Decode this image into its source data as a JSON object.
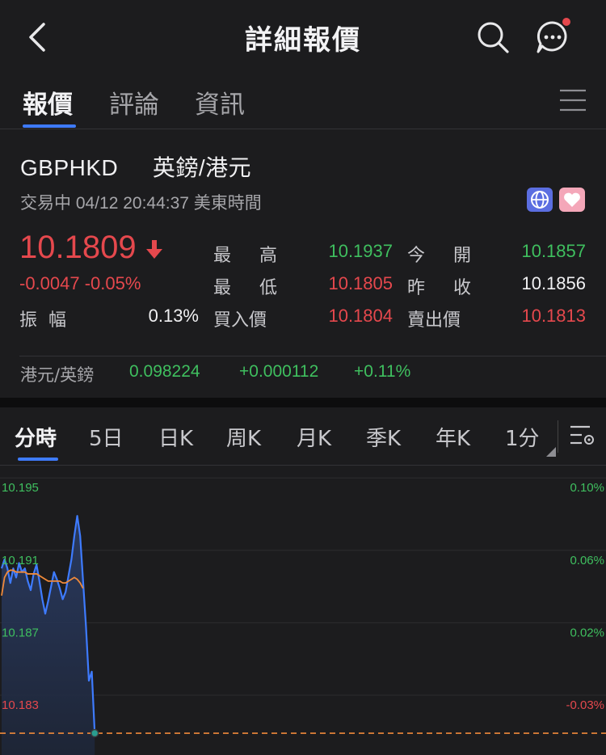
{
  "header": {
    "title": "詳細報價",
    "back_icon": "chevron-left-icon",
    "search_icon": "search-icon",
    "chat_icon": "chat-bubble-icon",
    "notification_dot_color": "#e5484d"
  },
  "tabs": [
    {
      "label": "報價",
      "active": true
    },
    {
      "label": "評論",
      "active": false
    },
    {
      "label": "資訊",
      "active": false
    }
  ],
  "quote": {
    "symbol": "GBPHKD",
    "name": "英鎊/港元",
    "status": "交易中 04/12 20:44:37 美東時間",
    "price": "10.1809",
    "direction": "down",
    "change": "-0.0047 -0.05%",
    "amplitude_label": "振幅",
    "amplitude_value": "0.13%",
    "stats": {
      "high_label": "最 高",
      "high": "10.1937",
      "open_label": "今 開",
      "open": "10.1857",
      "low_label": "最 低",
      "low": "10.1805",
      "prev_close_label": "昨 收",
      "prev_close": "10.1856",
      "bid_label": "買入價",
      "bid": "10.1804",
      "ask_label": "賣出價",
      "ask": "10.1813"
    },
    "inverse": {
      "label": "港元/英鎊",
      "value": "0.098224",
      "change": "+0.000112",
      "change_pct": "+0.11%"
    }
  },
  "chart_tabs": [
    {
      "label": "分時",
      "active": true
    },
    {
      "label": "5日",
      "active": false
    },
    {
      "label": "日K",
      "active": false
    },
    {
      "label": "周K",
      "active": false
    },
    {
      "label": "月K",
      "active": false
    },
    {
      "label": "季K",
      "active": false
    },
    {
      "label": "年K",
      "active": false
    },
    {
      "label": "1分",
      "active": false
    }
  ],
  "chart_data": {
    "type": "line",
    "y_left_labels": [
      "10.195",
      "10.191",
      "10.187",
      "10.183"
    ],
    "y_right_labels": [
      "0.10%",
      "0.06%",
      "0.02%",
      "-0.03%"
    ],
    "prev_close": 10.1856,
    "ylim": [
      10.1805,
      10.1955
    ],
    "series": [
      {
        "values": [
          10.19,
          10.1905,
          10.19,
          10.1892,
          10.19,
          10.1895,
          10.1903,
          10.1898,
          10.19,
          10.1893,
          10.1888,
          10.1897,
          10.1902,
          10.1893,
          10.1883,
          10.1875,
          10.1882,
          10.189,
          10.1898,
          10.1894,
          10.1889,
          10.1883,
          10.1887,
          10.1896,
          10.1905,
          10.1918,
          10.1929,
          10.1918,
          10.1893,
          10.1868,
          10.1838,
          10.1843,
          10.1809
        ]
      },
      {
        "values": [
          10.1885,
          10.1895,
          10.1898,
          10.1899,
          10.1899,
          10.1898,
          10.1898,
          10.1898,
          10.1898,
          10.1897,
          10.1897,
          10.1897,
          10.1897,
          10.1896,
          10.1895,
          10.1894,
          10.1893,
          10.1893,
          10.1893,
          10.1893,
          10.1893,
          10.1892,
          10.1892,
          10.1893,
          10.1894,
          10.1895,
          10.1894,
          10.1892,
          10.1889
        ]
      }
    ]
  },
  "colors": {
    "up": "#3fbf5f",
    "down": "#e5484d",
    "accent": "#3e7bff",
    "price_line": "#3e7bff",
    "avg_line": "#f08a3a"
  }
}
